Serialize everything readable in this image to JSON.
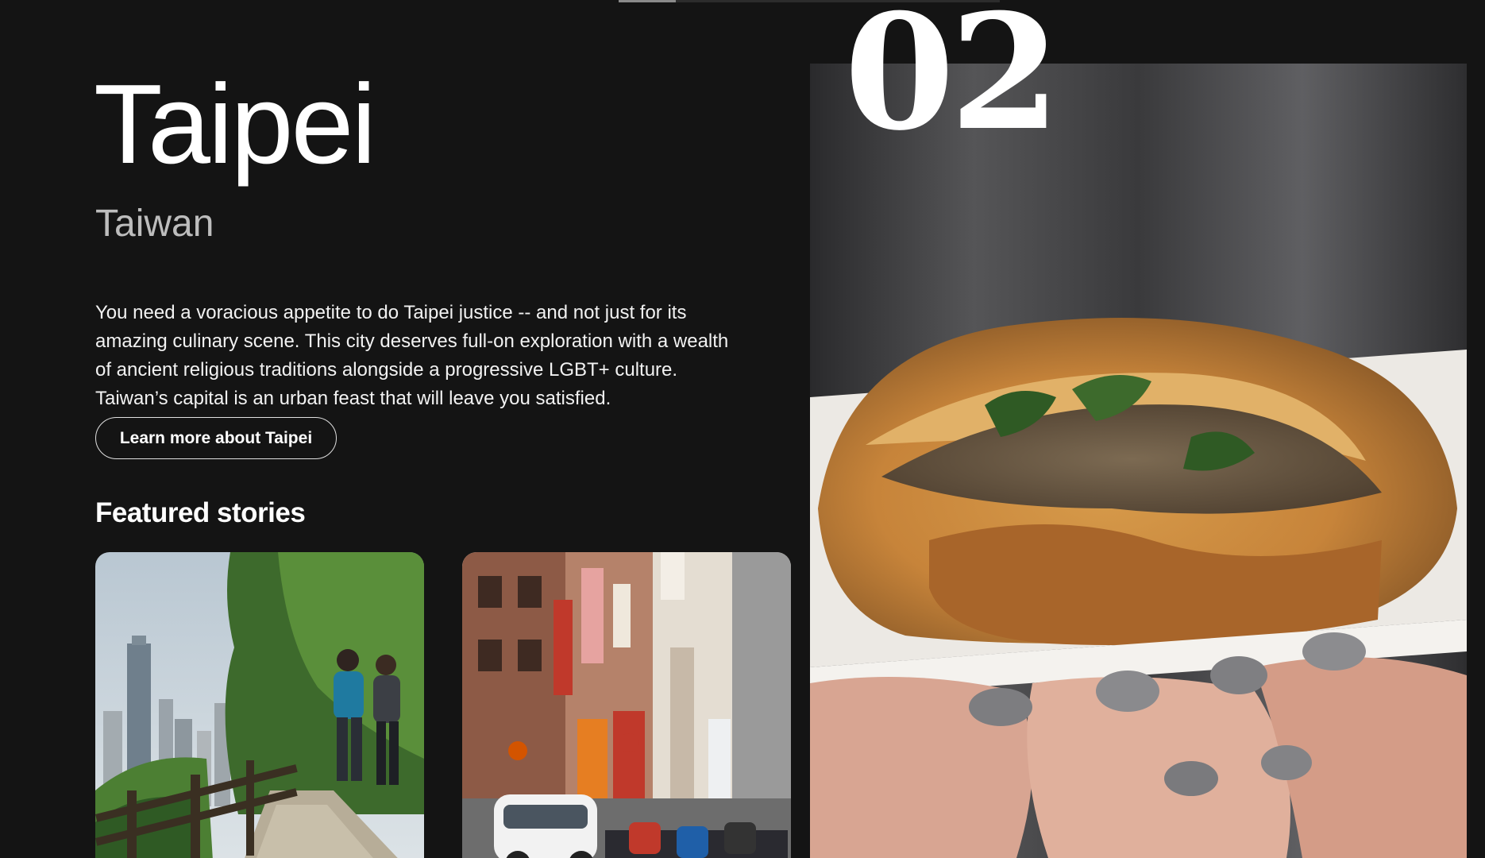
{
  "carousel": {
    "progress": 0.15,
    "slide_number": "02"
  },
  "destination": {
    "city": "Taipei",
    "country": "Taiwan",
    "description": "You need a voracious appetite to do Taipei justice -- and not just for its amazing culinary scene. This city deserves full-on exploration with a wealth of ancient religious traditions alongside a progressive LGBT+ culture. Taiwan’s capital is an urban feast that will leave you satisfied.",
    "cta_label": "Learn more about Taipei"
  },
  "featured": {
    "heading": "Featured stories"
  },
  "colors": {
    "background": "#141414",
    "text": "#ffffff",
    "muted_text": "#bdbdbd"
  }
}
